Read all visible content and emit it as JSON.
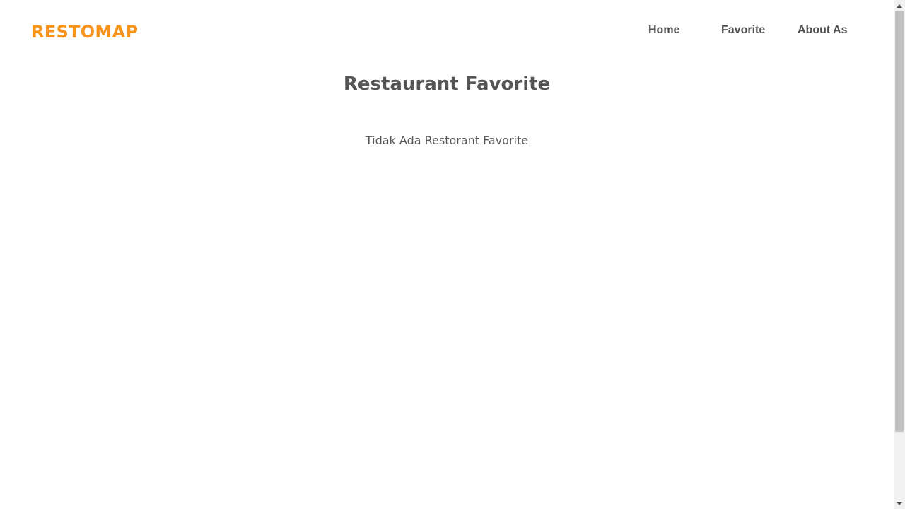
{
  "header": {
    "logo": "RESTOMAP",
    "nav": {
      "home": "Home",
      "favorite": "Favorite",
      "about": "About As"
    }
  },
  "main": {
    "title": "Restaurant Favorite",
    "empty_message": "Tidak Ada Restorant Favorite"
  },
  "colors": {
    "brand": "#f7941d",
    "text": "#555555",
    "background": "#ffffff"
  },
  "icons": {
    "scroll_up": "triangle-up-icon",
    "scroll_down": "triangle-down-icon"
  }
}
